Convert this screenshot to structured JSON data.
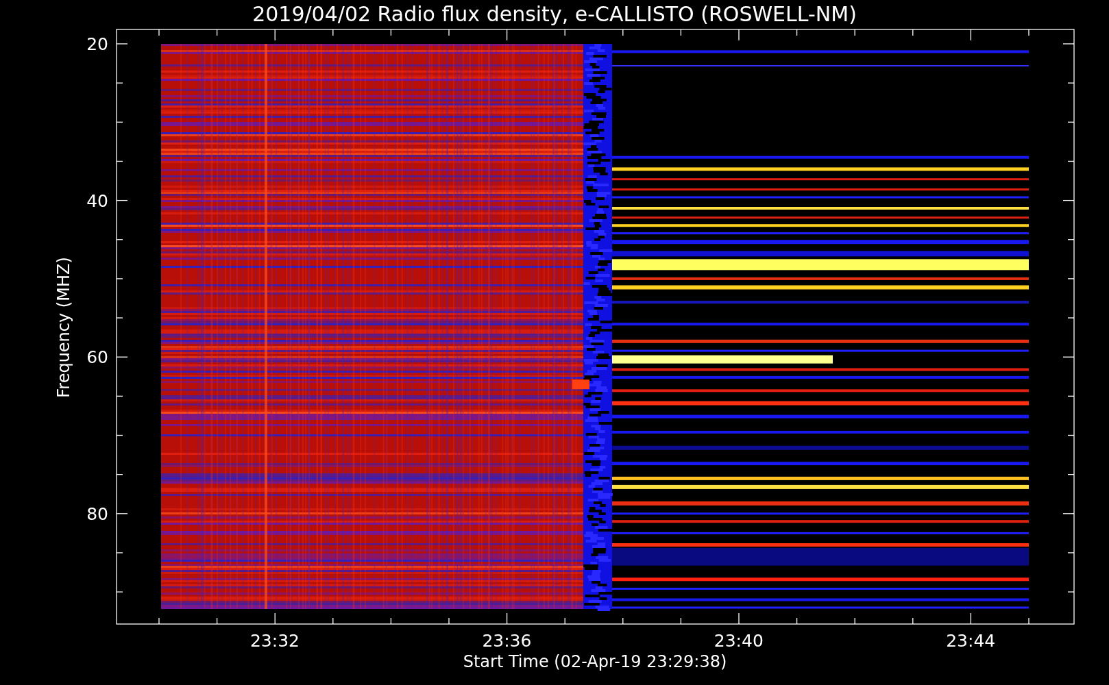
{
  "plot": {
    "title": "2019/04/02  Radio flux density, e-CALLISTO (ROSWELL-NM)",
    "ylabel": "Frequency (MHZ)",
    "xlabel": "Start Time (02-Apr-19 23:29:38)",
    "yticks": [
      {
        "label": "20"
      },
      {
        "label": "40"
      },
      {
        "label": "60"
      },
      {
        "label": "80"
      }
    ],
    "xticks": [
      {
        "label": "23:32"
      },
      {
        "label": "23:36"
      },
      {
        "label": "23:40"
      },
      {
        "label": "23:44"
      }
    ]
  }
}
